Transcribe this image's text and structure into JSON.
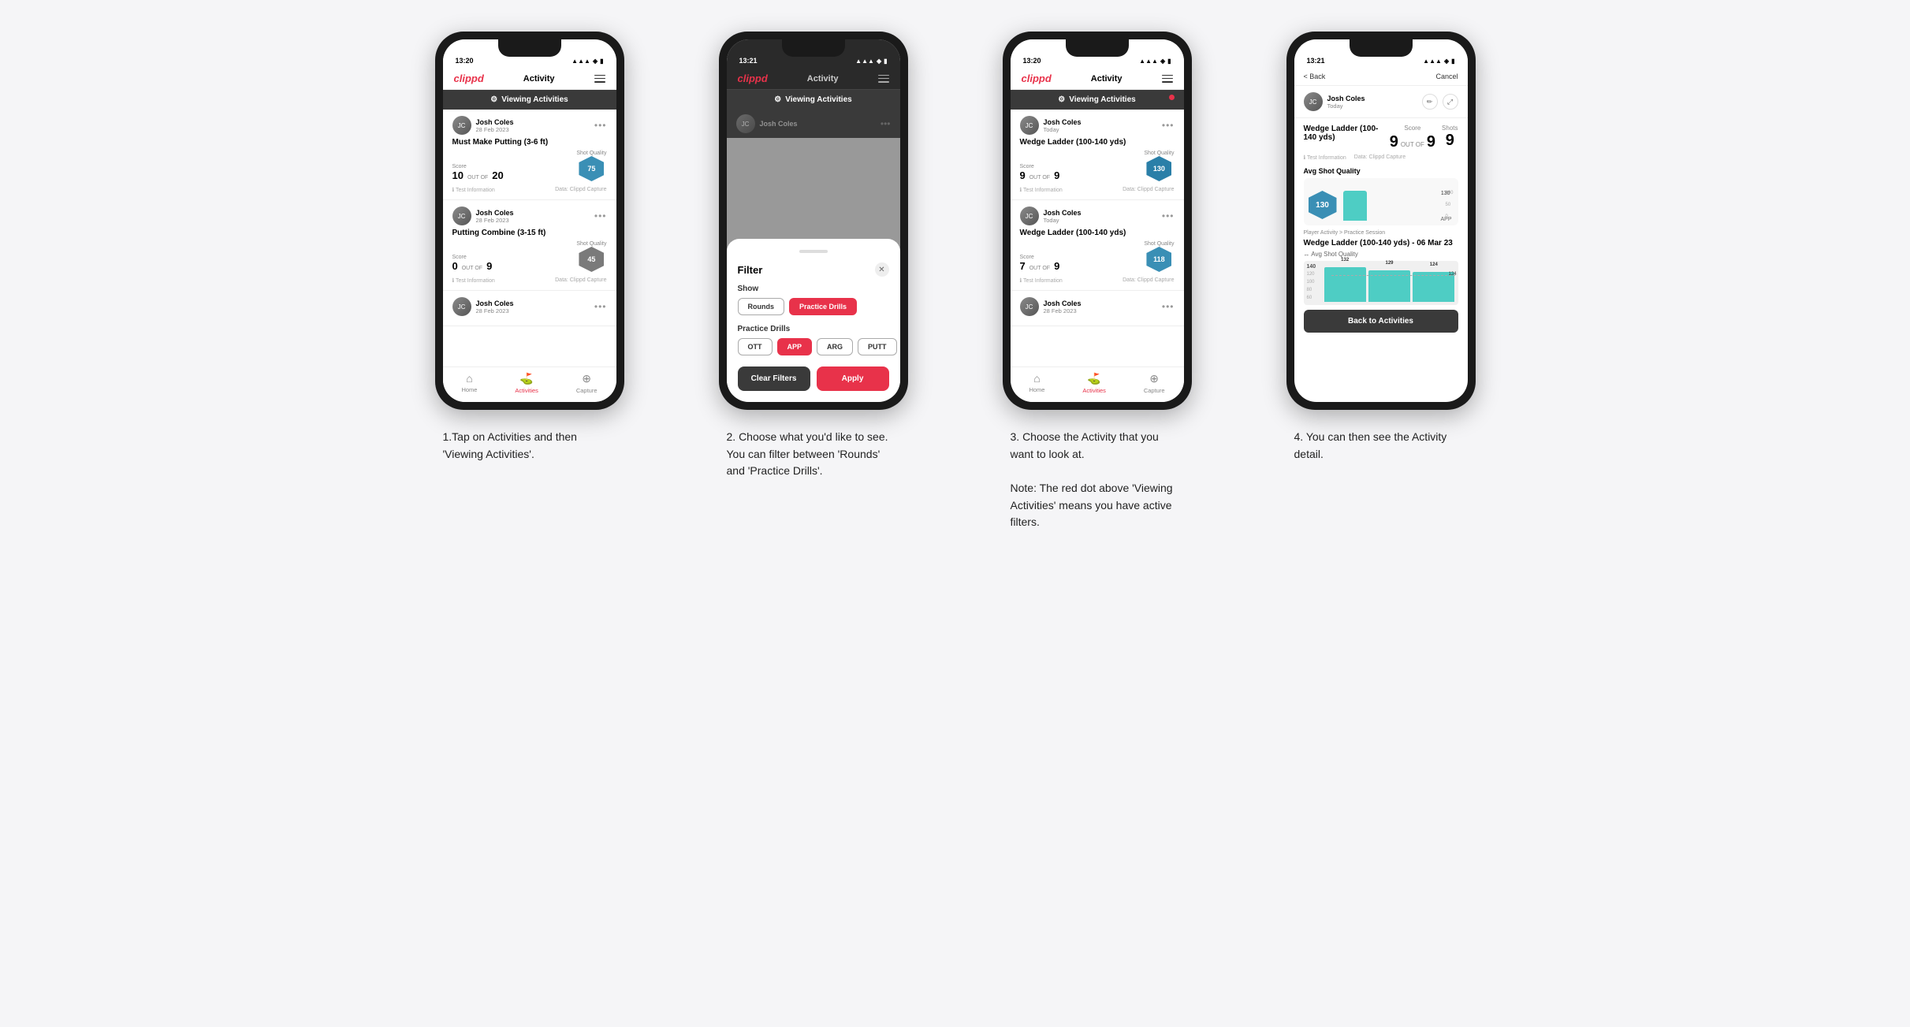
{
  "phones": [
    {
      "id": "phone1",
      "status_time": "13:20",
      "nav_logo": "clippd",
      "nav_title": "Activity",
      "banner_label": "Viewing Activities",
      "has_red_dot": false,
      "cards": [
        {
          "user_name": "Josh Coles",
          "user_date": "28 Feb 2023",
          "title": "Must Make Putting (3-6 ft)",
          "score_label": "Score",
          "score": "10",
          "shots_label": "Shots",
          "shots": "20",
          "quality_label": "Shot Quality",
          "quality": "75",
          "info_left": "Test Information",
          "info_right": "Data: Clippd Capture"
        },
        {
          "user_name": "Josh Coles",
          "user_date": "28 Feb 2023",
          "title": "Putting Combine (3-15 ft)",
          "score_label": "Score",
          "score": "0",
          "shots_label": "Shots",
          "shots": "9",
          "quality_label": "Shot Quality",
          "quality": "45",
          "info_left": "Test Information",
          "info_right": "Data: Clippd Capture"
        },
        {
          "user_name": "Josh Coles",
          "user_date": "28 Feb 2023",
          "title": "",
          "score": "",
          "shots": "",
          "quality": ""
        }
      ],
      "bottom_nav": [
        "Home",
        "Activities",
        "Capture"
      ],
      "active_nav": 1
    },
    {
      "id": "phone2",
      "status_time": "13:21",
      "nav_logo": "clippd",
      "nav_title": "Activity",
      "banner_label": "Viewing Activities",
      "filter_title": "Filter",
      "show_label": "Show",
      "pills_show": [
        "Rounds",
        "Practice Drills"
      ],
      "active_show_pill": 1,
      "drills_label": "Practice Drills",
      "pills_drills": [
        "OTT",
        "APP",
        "ARG",
        "PUTT"
      ],
      "active_drills": [
        "APP"
      ],
      "btn_clear": "Clear Filters",
      "btn_apply": "Apply"
    },
    {
      "id": "phone3",
      "status_time": "13:20",
      "nav_logo": "clippd",
      "nav_title": "Activity",
      "banner_label": "Viewing Activities",
      "has_red_dot": true,
      "cards": [
        {
          "user_name": "Josh Coles",
          "user_date": "Today",
          "title": "Wedge Ladder (100-140 yds)",
          "score_label": "Score",
          "score": "9",
          "shots_label": "Shots",
          "shots": "9",
          "quality_label": "Shot Quality",
          "quality": "130",
          "info_left": "Test Information",
          "info_right": "Data: Clippd Capture"
        },
        {
          "user_name": "Josh Coles",
          "user_date": "Today",
          "title": "Wedge Ladder (100-140 yds)",
          "score_label": "Score",
          "score": "7",
          "shots_label": "Shots",
          "shots": "9",
          "quality_label": "Shot Quality",
          "quality": "118",
          "info_left": "Test Information",
          "info_right": "Data: Clippd Capture"
        },
        {
          "user_name": "Josh Coles",
          "user_date": "28 Feb 2023",
          "title": "",
          "score": "",
          "shots": "",
          "quality": ""
        }
      ],
      "bottom_nav": [
        "Home",
        "Activities",
        "Capture"
      ],
      "active_nav": 1
    },
    {
      "id": "phone4",
      "status_time": "13:21",
      "nav_logo": "clippd",
      "back_label": "< Back",
      "cancel_label": "Cancel",
      "user_name": "Josh Coles",
      "user_date": "Today",
      "drill_title": "Wedge Ladder (100-140 yds)",
      "score_label": "Score",
      "shots_label": "Shots",
      "score": "9",
      "shots": "9",
      "info_text1": "Test Information",
      "info_text2": "Data: Clippd Capture",
      "avg_quality_label": "Avg Shot Quality",
      "quality_value": "130",
      "chart_label": "APP",
      "y_axis_vals": [
        "100",
        "50",
        "0"
      ],
      "practice_breadcrumb": "Player Activity > Practice Session",
      "practice_drill_title": "Wedge Ladder (100-140 yds) - 06 Mar 23",
      "practice_drill_subtitle": "↔ Avg Shot Quality",
      "bar_values": [
        132,
        129,
        124
      ],
      "bar_dashed_value": 124,
      "back_to_activities": "Back to Activities"
    }
  ],
  "descriptions": [
    "1.Tap on Activities and then 'Viewing Activities'.",
    "2. Choose what you'd like to see. You can filter between 'Rounds' and 'Practice Drills'.",
    "3. Choose the Activity that you want to look at.\n\nNote: The red dot above 'Viewing Activities' means you have active filters.",
    "4. You can then see the Activity detail."
  ]
}
